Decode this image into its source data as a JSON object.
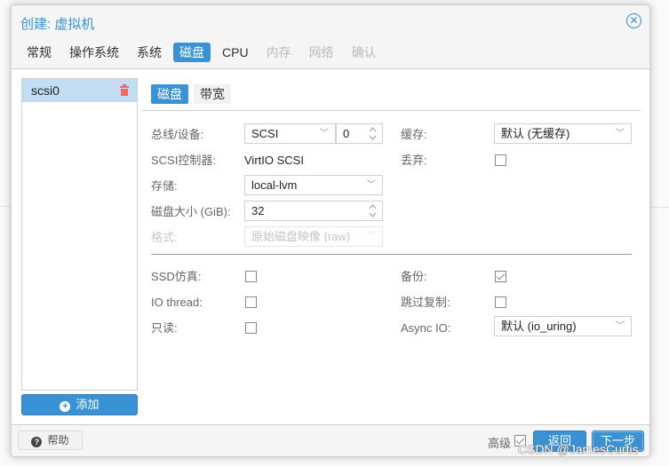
{
  "dialog": {
    "title": "创建: 虚拟机",
    "close_icon": "circle-x-icon"
  },
  "tabs": [
    {
      "label": "常规",
      "state": "normal"
    },
    {
      "label": "操作系统",
      "state": "normal"
    },
    {
      "label": "系统",
      "state": "normal"
    },
    {
      "label": "磁盘",
      "state": "active"
    },
    {
      "label": "CPU",
      "state": "normal"
    },
    {
      "label": "内存",
      "state": "disabled"
    },
    {
      "label": "网络",
      "state": "disabled"
    },
    {
      "label": "确认",
      "state": "disabled"
    }
  ],
  "disk_list": {
    "items": [
      {
        "label": "scsi0",
        "selected": true,
        "delete_icon": "trash-icon"
      }
    ],
    "add_label": "添加"
  },
  "subtabs": [
    {
      "label": "磁盘",
      "active": true
    },
    {
      "label": "带宽",
      "active": false
    }
  ],
  "form": {
    "bus_device": {
      "label": "总线/设备:",
      "bus": "SCSI",
      "device": "0"
    },
    "scsi_controller": {
      "label": "SCSI控制器:",
      "value": "VirtIO SCSI"
    },
    "storage": {
      "label": "存储:",
      "value": "local-lvm"
    },
    "disk_size": {
      "label": "磁盘大小 (GiB):",
      "value": "32"
    },
    "format": {
      "label": "格式:",
      "value": "原始磁盘映像 (raw)",
      "disabled": true
    },
    "cache": {
      "label": "缓存:",
      "value": "默认 (无缓存)"
    },
    "discard": {
      "label": "丢弃:",
      "checked": false
    },
    "ssd_emulation": {
      "label": "SSD仿真:",
      "checked": false
    },
    "io_thread": {
      "label": "IO thread:",
      "checked": false
    },
    "read_only": {
      "label": "只读:",
      "checked": false
    },
    "backup": {
      "label": "备份:",
      "checked": true
    },
    "skip_replication": {
      "label": "跳过复制:",
      "checked": false
    },
    "async_io": {
      "label": "Async IO:",
      "value": "默认 (io_uring)"
    }
  },
  "footer": {
    "help_label": "帮助",
    "advanced_label": "高级",
    "advanced_checked": true,
    "back_label": "返回",
    "next_label": "下一步"
  },
  "watermark": "CSDN @JamesCurtis",
  "colors": {
    "accent": "#3892d4",
    "selected_row": "#c2ddf2",
    "delete": "#f0685a"
  }
}
